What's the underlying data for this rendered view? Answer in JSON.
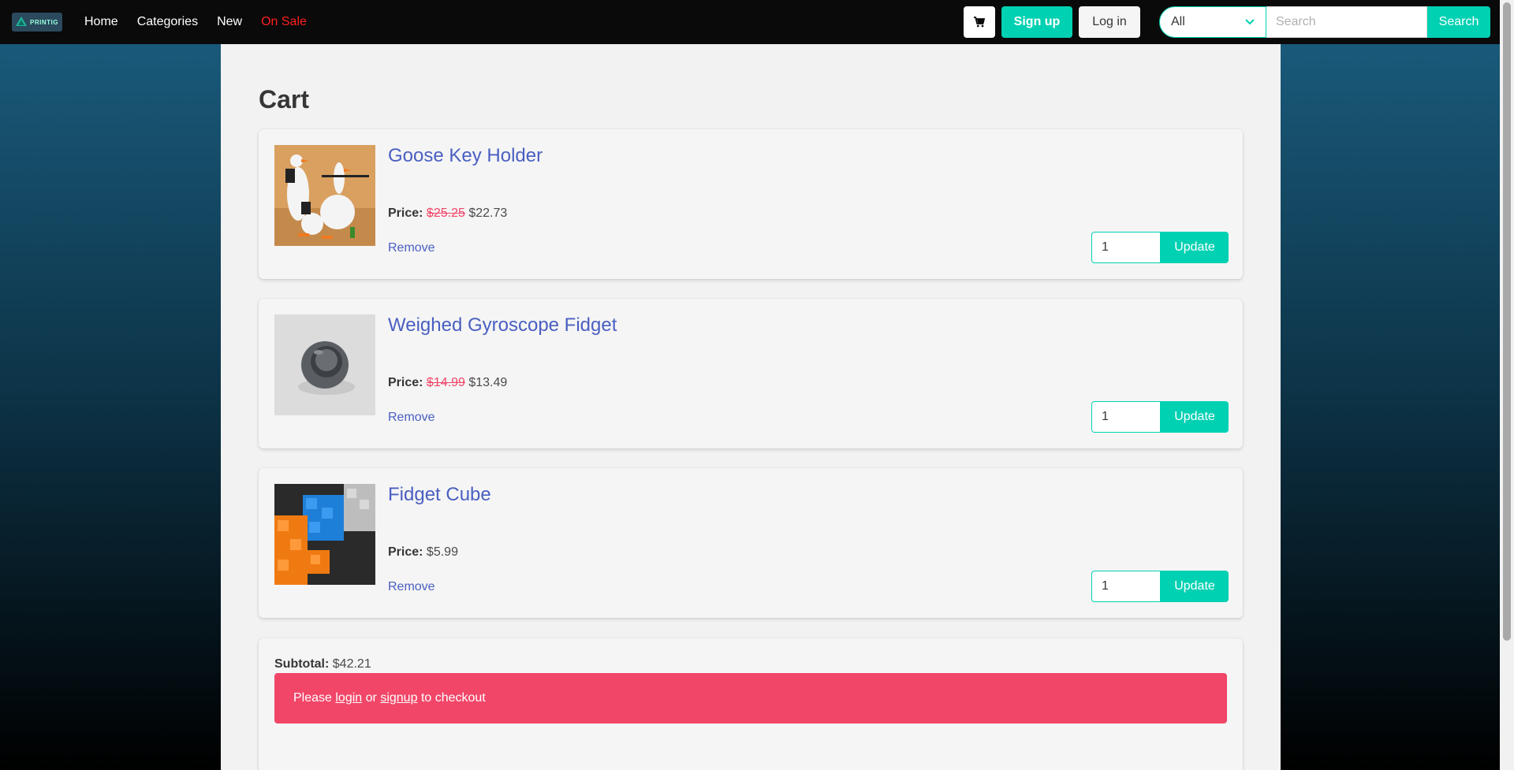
{
  "brand": {
    "logo_text": "PRINTIG"
  },
  "nav": {
    "links": [
      {
        "label": "Home"
      },
      {
        "label": "Categories"
      },
      {
        "label": "New"
      },
      {
        "label": "On Sale"
      }
    ],
    "signup_label": "Sign up",
    "login_label": "Log in",
    "search": {
      "category_value": "All",
      "placeholder": "Search",
      "button_label": "Search"
    }
  },
  "page": {
    "title": "Cart"
  },
  "cart": {
    "price_label": "Price:",
    "remove_label": "Remove",
    "update_label": "Update",
    "items": [
      {
        "name": "Goose Key Holder",
        "old_price": "$25.25",
        "price": "$22.73",
        "quantity": "1"
      },
      {
        "name": "Weighed Gyroscope Fidget",
        "old_price": "$14.99",
        "price": "$13.49",
        "quantity": "1"
      },
      {
        "name": "Fidget Cube",
        "old_price": "",
        "price": "$5.99",
        "quantity": "1"
      }
    ]
  },
  "summary": {
    "subtotal_label": "Subtotal:",
    "subtotal_value": "$42.21",
    "notice_prefix": "Please",
    "login_link": "login",
    "or_text": "or",
    "signup_link": "signup",
    "notice_suffix": "to checkout"
  },
  "colors": {
    "accent": "#00d1b2",
    "danger": "#f14668",
    "link": "#4a5fc1",
    "sale": "#ff1f1f"
  }
}
